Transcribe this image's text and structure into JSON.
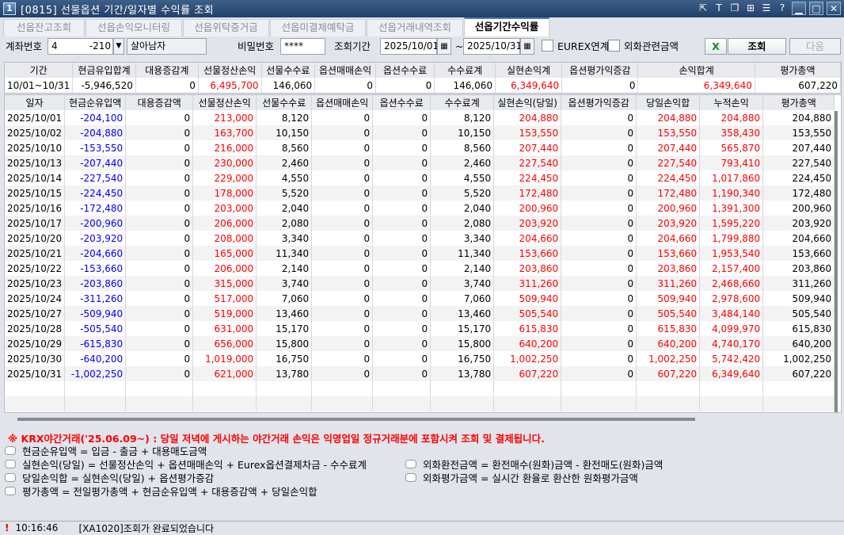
{
  "window": {
    "title": "[0815] 선물옵션 기간/일자별 수익률 조회",
    "app_number": "1"
  },
  "tabs": [
    "선옵잔고조회",
    "선옵손익모니터링",
    "선옵위탁증거금",
    "선옵미결제예탁금",
    "선옵거래내역조회",
    "선옵기간수익률"
  ],
  "controls": {
    "account_label": "계좌번호",
    "account_prefix": "4",
    "account_suffix": "-210",
    "account_name": "살아남자",
    "password_label": "비밀번호",
    "password_value": "****",
    "period_label": "조회기간",
    "date_from": "2025/10/01",
    "tilde": "~",
    "date_to": "2025/10/31",
    "eurex_label": "EUREX연계",
    "fx_label": "외화관련금액",
    "query_button": "조회",
    "next_button": "다음"
  },
  "summary": {
    "headers": [
      "기간",
      "현금유입합계",
      "대용증감계",
      "선물정산손익",
      "선물수수료",
      "옵션매매손익",
      "옵션수수료",
      "수수료계",
      "실현손익계",
      "옵션평가익증감",
      "손익합계",
      "평가총액"
    ],
    "row": [
      "10/01~10/31",
      "-5,946,520",
      "0",
      "6,495,700",
      "146,060",
      "0",
      "0",
      "146,060",
      "6,349,640",
      "0",
      "6,349,640",
      "607,220"
    ]
  },
  "grid": {
    "headers": [
      "일자",
      "현금순유입액",
      "대용증감액",
      "선물정산손익",
      "선물수수료",
      "옵션매매손익",
      "옵션수수료",
      "수수료계",
      "실현손익(당일)",
      "옵션평가익증감",
      "당일손익합",
      "누적손익",
      "평가총액"
    ],
    "rows": [
      [
        "2025/10/01",
        "-204,100",
        "0",
        "213,000",
        "8,120",
        "0",
        "0",
        "8,120",
        "204,880",
        "0",
        "204,880",
        "204,880",
        "204,880"
      ],
      [
        "2025/10/02",
        "-204,880",
        "0",
        "163,700",
        "10,150",
        "0",
        "0",
        "10,150",
        "153,550",
        "0",
        "153,550",
        "358,430",
        "153,550"
      ],
      [
        "2025/10/10",
        "-153,550",
        "0",
        "216,000",
        "8,560",
        "0",
        "0",
        "8,560",
        "207,440",
        "0",
        "207,440",
        "565,870",
        "207,440"
      ],
      [
        "2025/10/13",
        "-207,440",
        "0",
        "230,000",
        "2,460",
        "0",
        "0",
        "2,460",
        "227,540",
        "0",
        "227,540",
        "793,410",
        "227,540"
      ],
      [
        "2025/10/14",
        "-227,540",
        "0",
        "229,000",
        "4,550",
        "0",
        "0",
        "4,550",
        "224,450",
        "0",
        "224,450",
        "1,017,860",
        "224,450"
      ],
      [
        "2025/10/15",
        "-224,450",
        "0",
        "178,000",
        "5,520",
        "0",
        "0",
        "5,520",
        "172,480",
        "0",
        "172,480",
        "1,190,340",
        "172,480"
      ],
      [
        "2025/10/16",
        "-172,480",
        "0",
        "203,000",
        "2,040",
        "0",
        "0",
        "2,040",
        "200,960",
        "0",
        "200,960",
        "1,391,300",
        "200,960"
      ],
      [
        "2025/10/17",
        "-200,960",
        "0",
        "206,000",
        "2,080",
        "0",
        "0",
        "2,080",
        "203,920",
        "0",
        "203,920",
        "1,595,220",
        "203,920"
      ],
      [
        "2025/10/20",
        "-203,920",
        "0",
        "208,000",
        "3,340",
        "0",
        "0",
        "3,340",
        "204,660",
        "0",
        "204,660",
        "1,799,880",
        "204,660"
      ],
      [
        "2025/10/21",
        "-204,660",
        "0",
        "165,000",
        "11,340",
        "0",
        "0",
        "11,340",
        "153,660",
        "0",
        "153,660",
        "1,953,540",
        "153,660"
      ],
      [
        "2025/10/22",
        "-153,660",
        "0",
        "206,000",
        "2,140",
        "0",
        "0",
        "2,140",
        "203,860",
        "0",
        "203,860",
        "2,157,400",
        "203,860"
      ],
      [
        "2025/10/23",
        "-203,860",
        "0",
        "315,000",
        "3,740",
        "0",
        "0",
        "3,740",
        "311,260",
        "0",
        "311,260",
        "2,468,660",
        "311,260"
      ],
      [
        "2025/10/24",
        "-311,260",
        "0",
        "517,000",
        "7,060",
        "0",
        "0",
        "7,060",
        "509,940",
        "0",
        "509,940",
        "2,978,600",
        "509,940"
      ],
      [
        "2025/10/27",
        "-509,940",
        "0",
        "519,000",
        "13,460",
        "0",
        "0",
        "13,460",
        "505,540",
        "0",
        "505,540",
        "3,484,140",
        "505,540"
      ],
      [
        "2025/10/28",
        "-505,540",
        "0",
        "631,000",
        "15,170",
        "0",
        "0",
        "15,170",
        "615,830",
        "0",
        "615,830",
        "4,099,970",
        "615,830"
      ],
      [
        "2025/10/29",
        "-615,830",
        "0",
        "656,000",
        "15,800",
        "0",
        "0",
        "15,800",
        "640,200",
        "0",
        "640,200",
        "4,740,170",
        "640,200"
      ],
      [
        "2025/10/30",
        "-640,200",
        "0",
        "1,019,000",
        "16,750",
        "0",
        "0",
        "16,750",
        "1,002,250",
        "0",
        "1,002,250",
        "5,742,420",
        "1,002,250"
      ],
      [
        "2025/10/31",
        "-1,002,250",
        "0",
        "621,000",
        "13,780",
        "0",
        "0",
        "13,780",
        "607,220",
        "0",
        "607,220",
        "6,349,640",
        "607,220"
      ]
    ]
  },
  "notes": {
    "warning": "※ KRX야간거래('25.06.09~) : 당일 저녁에 게시하는 야간거래 손익은 익영업일 정규거래분에 포함시켜 조회 및 결제됩니다.",
    "left": [
      "현금순유입액 = 입금 - 출금 + 대용매도금액",
      "실현손익(당일) = 선물정산손익 + 옵션매매손익 + Eurex옵션결제차금 - 수수료계",
      "당일손익합 = 실현손익(당일) + 옵션평가증감",
      "평가총액 = 전일평가총액 + 현금순유입액 + 대용증감액 + 당일손익합"
    ],
    "right": [
      "외화환전금액 = 환전매수(원화)금액 - 환전매도(원화)금액",
      "외화평가금액 = 실시간 환율로 환산한 원화평가금액"
    ]
  },
  "status": {
    "time": "10:16:46",
    "message": "[XA1020]조회가 완료되었습니다"
  },
  "colors": {
    "negative": "#0000ff",
    "positive": "#ff0000",
    "title_bar": "#2b4a74"
  }
}
